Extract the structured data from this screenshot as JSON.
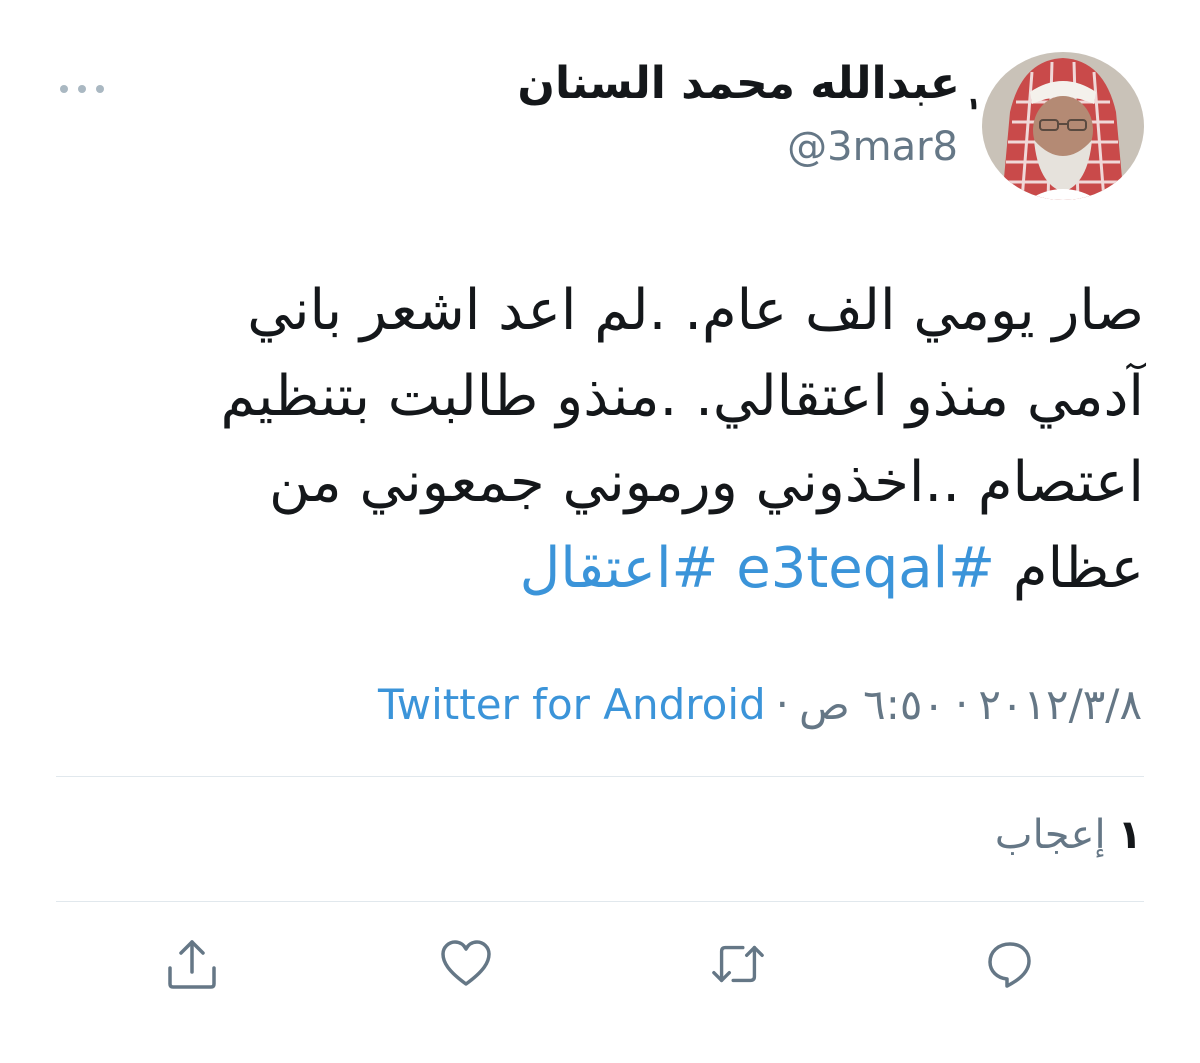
{
  "tweet": {
    "author": {
      "display_name": "ٖعبدالله محمد السنان",
      "handle": "@3mar8"
    },
    "text_lines": [
      "صار يومي الف عام. .لم اعد اشعر باني",
      "آدمي منذو اعتقالي. .منذو طالبت بتنظيم",
      "اعتصام ..اخذوني ورموني جمعوني من"
    ],
    "last_line_text": "عظام",
    "hashtags": [
      "#e3teqal",
      "#اعتقال"
    ],
    "date": "٢٠١٢/٣/٨",
    "time": "٦:٥٠ ص",
    "source": "Twitter for Android",
    "meta_separator": "·",
    "likes": {
      "count": "١",
      "label": "إعجاب"
    }
  },
  "icons": {
    "more": "more-dots-icon",
    "reply": "reply-bubble-icon",
    "retweet": "retweet-icon",
    "like": "heart-icon",
    "share": "share-upload-icon"
  },
  "colors": {
    "link": "#3b94d9",
    "secondary_text": "#657786",
    "icon": "#657786",
    "divider": "#e1e8ed"
  }
}
